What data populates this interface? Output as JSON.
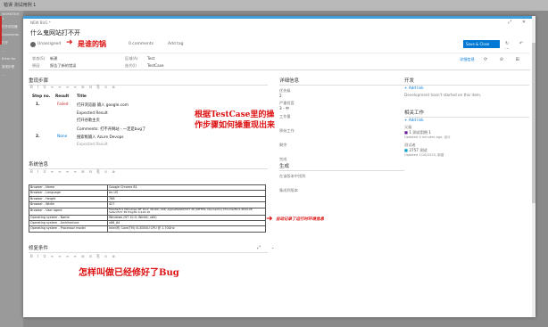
{
  "background": {
    "title": "错误 测试用例 1",
    "side_lines": [
      "WORKITEM 1",
      "打开浏览器",
      "Comments",
      "打开",
      "...",
      "Enter for",
      "重现步骤",
      "..."
    ]
  },
  "dialog": {
    "header_small": "NEW BUG *",
    "window_controls": "⤢ ✕",
    "title": "什么鬼网站打不开",
    "assigned": "Unassigned",
    "comments_label": "0 comments",
    "add_tag_label": "Add tag",
    "save_label": "Save & Close",
    "meta_icons": "↻ ↶ ⋯",
    "annotation_title": "是谁的锅",
    "annotation_steps": "根据TestCase里的操作步骤如何操重现出来",
    "annotation_sysinfo": "自动记录了运行时环境信息",
    "annotation_fixed": "怎样叫做已经修好了Bug"
  },
  "fields": {
    "state_label": "状态(S)",
    "state_value": "新建",
    "reason_label": "原因",
    "reason_value": "报告了新的错误",
    "area_label": "区域(A)",
    "area_value": "Test",
    "iteration_label": "迭代(I)",
    "iteration_value": "TestCase",
    "tab_details": "详细信息",
    "tab_icons": "⟳ ⊘ ⊞"
  },
  "steps": {
    "title": "重现步骤",
    "toolbar": "B I U ≡ ≡ ≡ ≡ ⊞ ⊟ ⎘ ⊙ ⊗",
    "col_step": "Step no.",
    "col_result": "Result",
    "col_title": "Title",
    "rows": [
      {
        "no": "1.",
        "result": "Failed",
        "title": "打开浏览器 输入 google.com"
      },
      {
        "no": "",
        "result": "",
        "title": "Expected Result"
      },
      {
        "no": "",
        "result": "",
        "title": "打开谷歌主页"
      },
      {
        "no": "",
        "result": "",
        "title": "Comments: 打不开网站 - 一定是bug了"
      },
      {
        "no": "2.",
        "result": "None",
        "title": "搜索框输入 Azure Devops"
      },
      {
        "no": "",
        "result": "",
        "title": "Expected Result"
      }
    ]
  },
  "sysinfo": {
    "title": "系统信息",
    "toolbar": "B I U ≡ ≡ ≡ ≡ ⊞ ⊟ ⎘ ⊙ ⊗",
    "rows": [
      {
        "k": "Browser - Name",
        "v": "Google Chrome 81"
      },
      {
        "k": "Browser - Language",
        "v": "en-US"
      },
      {
        "k": "Browser - Height",
        "v": "788"
      },
      {
        "k": "Browser - Width",
        "v": "427"
      },
      {
        "k": "Browser - User agent",
        "v": "Mozilla/5.0 (Windows NT 10.0; Win64; x64) AppleWebKit/537.36 (KHTML, like Gecko) Chrome/81.0.4044.26 Safari/537.36 Edg/81.0.416.16"
      },
      {
        "k": "Operating system - Name",
        "v": "Windows (NT 10.0; Win64; x64)"
      },
      {
        "k": "Operating system - Architecture",
        "v": "x86_64"
      },
      {
        "k": "Operating system - Processor model",
        "v": "Intel(R) Core(TM) i5-8350U CPU @ 1.70GHz"
      }
    ]
  },
  "fixed": {
    "title": "修复条件",
    "toolbar": "B I U ≡ ≡ ≡ ≡ ⊞ ⊟ ⎘ ⊙ ⊗"
  },
  "details": {
    "title": "详细信息",
    "priority_label": "优先级",
    "priority_value": "2",
    "severity_label": "严重程度",
    "severity_value": "3 - 中",
    "activity_label": "工作量",
    "original_label": "原始工作",
    "remaining_label": "剩余",
    "completed_label": "完成"
  },
  "build": {
    "title": "生成",
    "found_label": "在该版本中找到",
    "integrated_label": "集成到版本"
  },
  "development": {
    "title": "开发",
    "add_link": "+ Add link",
    "dev_text": "Development hasn't started on this item."
  },
  "related": {
    "title": "相关工作",
    "add_link": "+ Add link",
    "parent_label": "父级",
    "tested_by_label": "测试者",
    "items": [
      {
        "id": "1",
        "name": "测试用例 1",
        "meta": "Updated 4 minutes ago, 设计"
      },
      {
        "id": "2757",
        "name": "测试",
        "meta": "Updated 1/16/2020, 新建"
      }
    ]
  }
}
